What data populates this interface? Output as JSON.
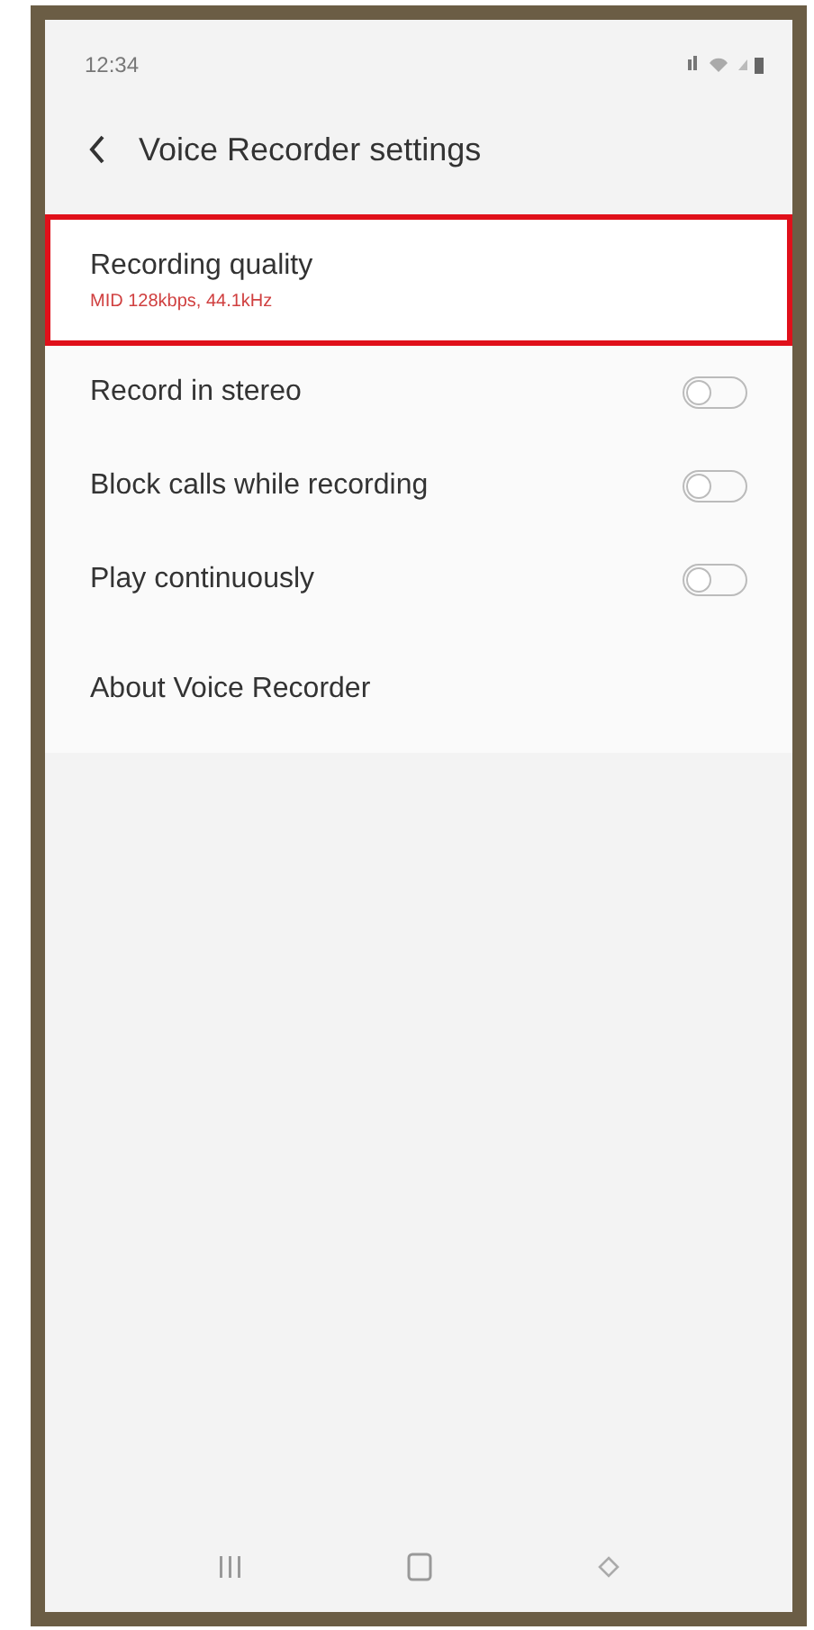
{
  "status_bar": {
    "time": "12:34"
  },
  "header": {
    "title": "Voice Recorder settings"
  },
  "settings": [
    {
      "kind": "detail",
      "label": "Recording quality",
      "value": "MID 128kbps, 44.1kHz",
      "highlighted": true
    },
    {
      "kind": "toggle",
      "label": "Record in stereo",
      "on": false
    },
    {
      "kind": "toggle",
      "label": "Block calls while recording",
      "on": false
    },
    {
      "kind": "toggle",
      "label": "Play continuously",
      "on": false
    },
    {
      "kind": "link",
      "label": "About Voice Recorder"
    }
  ]
}
